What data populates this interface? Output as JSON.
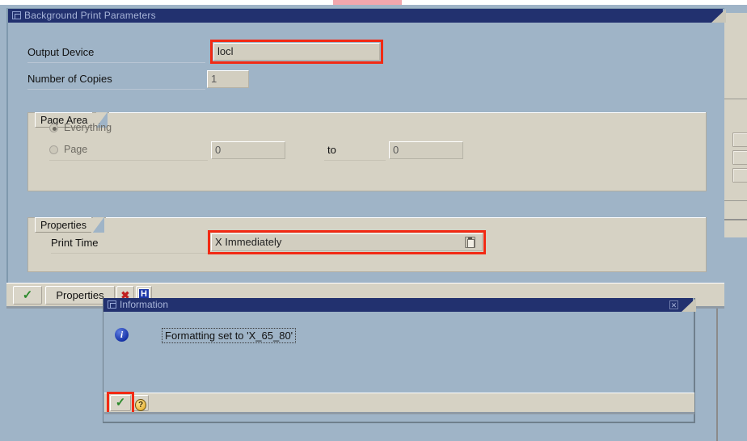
{
  "background": {
    "highlight_bar_color": "#f2a7ad"
  },
  "main_dialog": {
    "title": "Background Print Parameters",
    "fields": [
      {
        "label": "Output Device",
        "value": "locl",
        "highlighted": true
      },
      {
        "label": "Number of Copies",
        "value": "1",
        "highlighted": false
      }
    ],
    "page_area": {
      "legend": "Page Area",
      "options": [
        {
          "label": "Everything",
          "selected": true
        },
        {
          "label": "Page",
          "selected": false
        }
      ],
      "from_value": "0",
      "to_label": "to",
      "to_value": "0"
    },
    "properties": {
      "legend": "Properties",
      "print_time_label": "Print Time",
      "print_time_value": "X Immediately",
      "matchcode_icon": "matchcode-icon"
    },
    "toolbar": {
      "confirm_icon": "check-icon",
      "confirm_label": "✓",
      "properties_label": "Properties",
      "cancel_icon": "cancel-x-icon",
      "cancel_label": "✖",
      "help_icon": "h-icon",
      "help_label": "H"
    }
  },
  "info_dialog": {
    "title": "Information",
    "close_label": "✕",
    "icon": "info-icon",
    "icon_label": "i",
    "message": "Formatting set to 'X_65_80'",
    "buttons": [
      {
        "name": "continue-button",
        "label": "✓",
        "icon": "check-icon",
        "highlighted": true
      },
      {
        "name": "help-button",
        "label": "?",
        "icon": "question-icon",
        "highlighted": false
      }
    ]
  }
}
